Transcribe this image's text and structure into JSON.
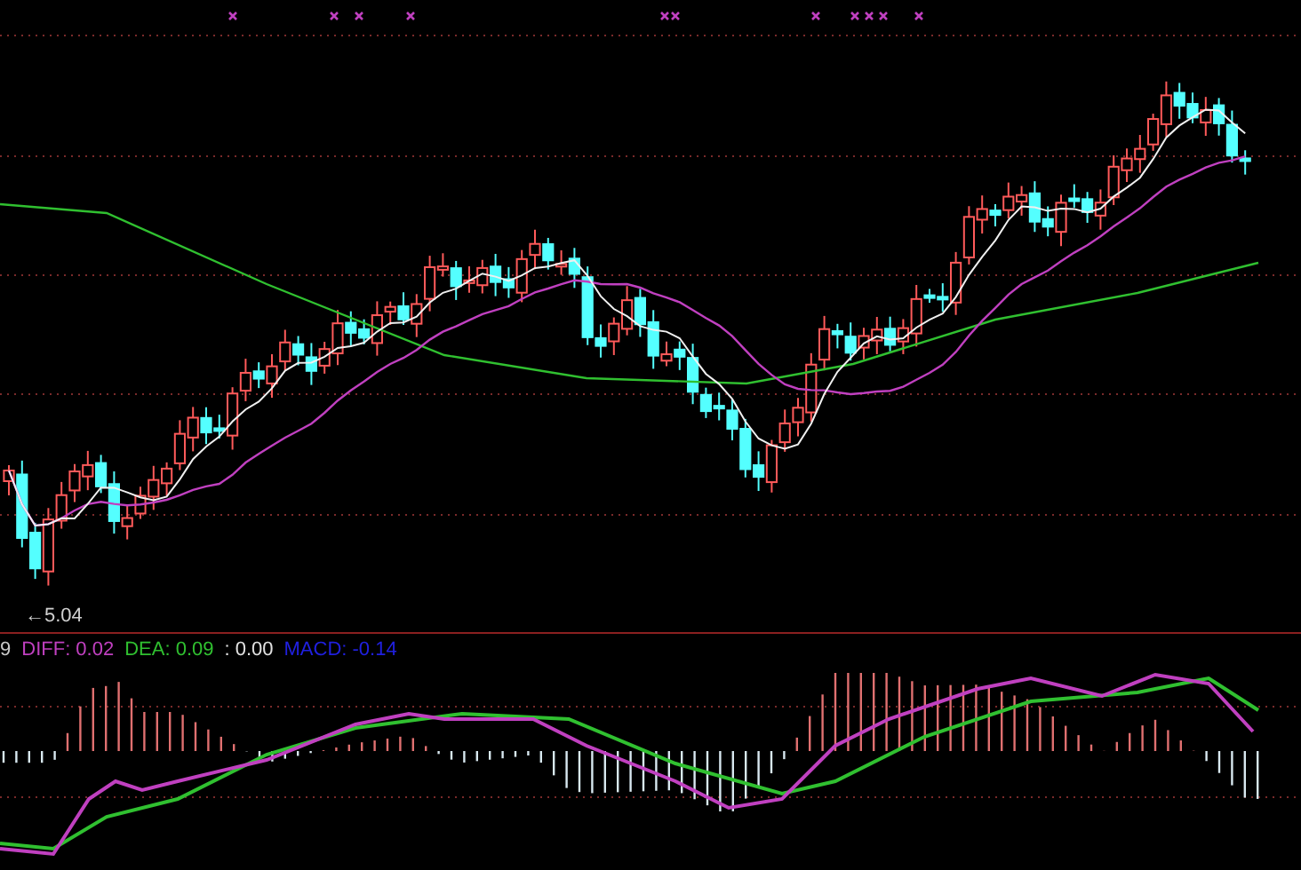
{
  "price_panel": {
    "low_label": "←5.04"
  },
  "macd_panel": {
    "labels": [
      {
        "text": "9",
        "color": "#c8c8c8"
      },
      {
        "text": "DIFF: 0.02",
        "color": "#c040c0"
      },
      {
        "text": "DEA: 0.09",
        "color": "#30c030"
      },
      {
        "text": ": 0.00",
        "color": "#e0e0e0"
      },
      {
        "text": "MACD: -0.14",
        "color": "#2020e0"
      }
    ]
  }
}
